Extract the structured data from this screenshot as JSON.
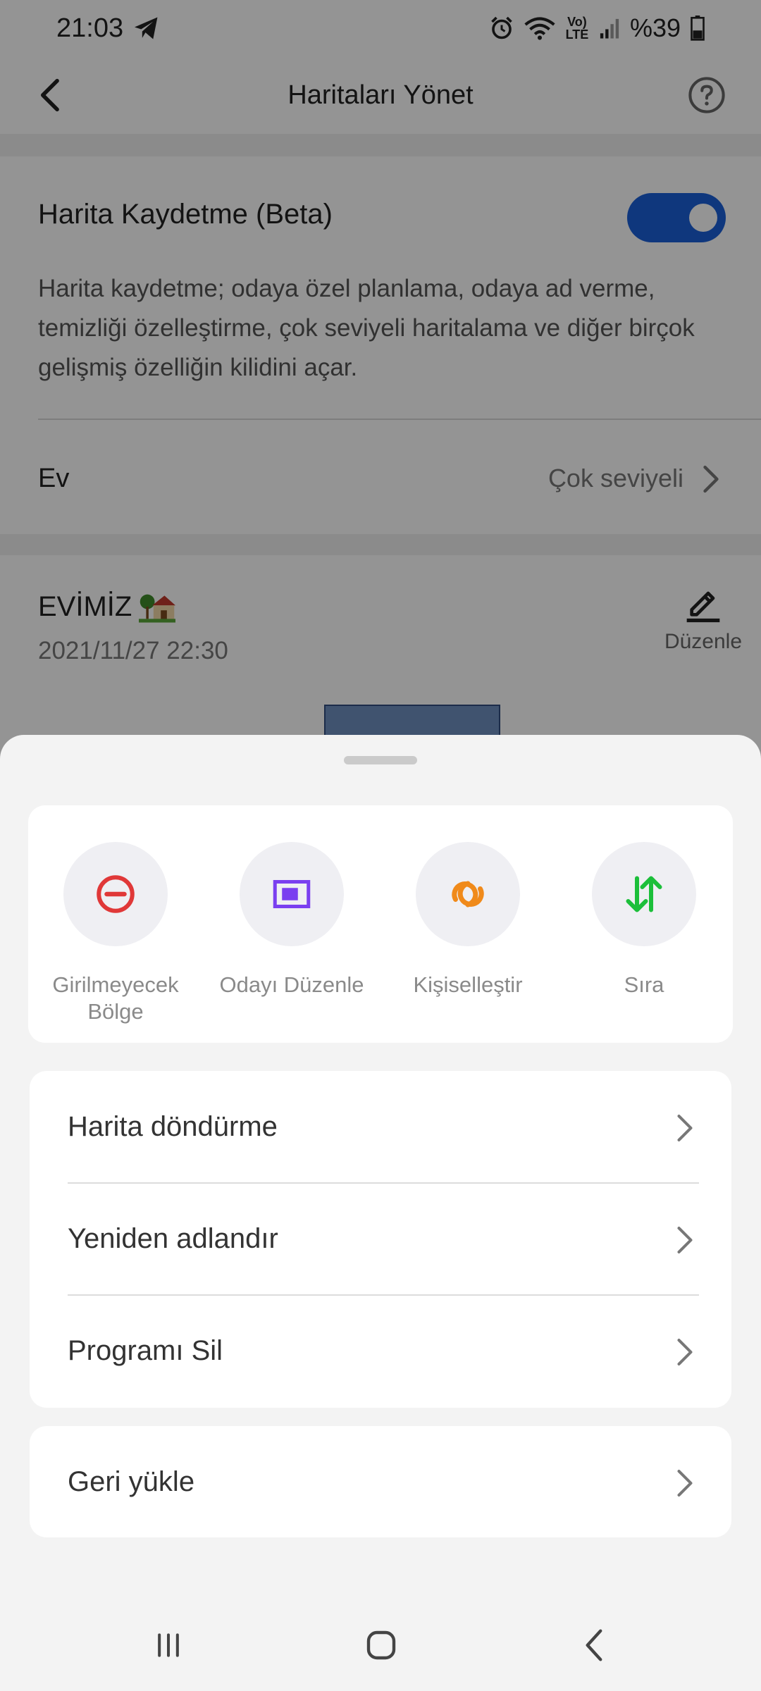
{
  "status": {
    "time": "21:03",
    "battery": "%39",
    "network": "Vo) LTE"
  },
  "header": {
    "title": "Haritaları Yönet"
  },
  "map_saving": {
    "title": "Harita Kaydetme (Beta)",
    "enabled": true,
    "description": "Harita kaydetme; odaya özel planlama, odaya ad verme, temizliği özelleştirme, çok seviyeli haritalama ve diğer birçok gelişmiş özelliğin kilidini açar.",
    "home_label": "Ev",
    "home_value": "Çok seviyeli"
  },
  "map": {
    "name": "EVİMİZ",
    "date": "2021/11/27 22:30",
    "edit_label": "Düzenle"
  },
  "sheet": {
    "actions": [
      {
        "label": "Girilmeyecek Bölge",
        "icon": "no-go-zone-icon",
        "color": "#e03838"
      },
      {
        "label": "Odayı Düzenle",
        "icon": "edit-room-icon",
        "color": "#7a3ff0"
      },
      {
        "label": "Kişiselleştir",
        "icon": "customize-icon",
        "color": "#f08a1a"
      },
      {
        "label": "Sıra",
        "icon": "sort-order-icon",
        "color": "#1cbf3a"
      }
    ],
    "list": [
      {
        "label": "Harita döndürme"
      },
      {
        "label": "Yeniden adlandır"
      },
      {
        "label": "Programı Sil"
      }
    ],
    "restore_label": "Geri yükle"
  },
  "colors": {
    "accent": "#1a5fd8"
  }
}
